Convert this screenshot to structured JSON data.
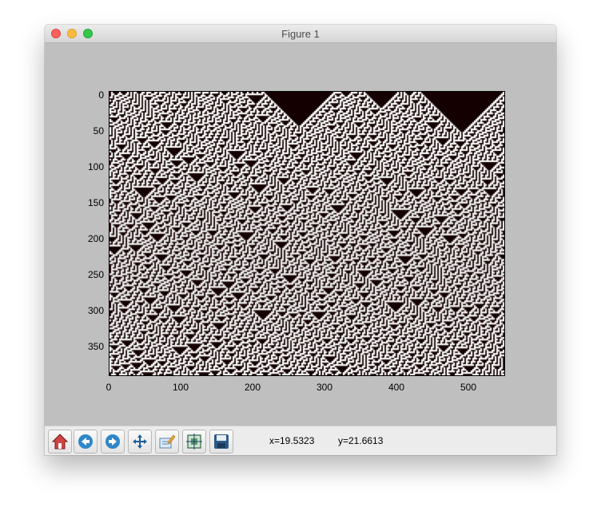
{
  "window": {
    "title": "Figure 1"
  },
  "axes": {
    "y_ticks": [
      "0",
      "50",
      "100",
      "150",
      "200",
      "250",
      "300",
      "350"
    ],
    "x_ticks": [
      "0",
      "100",
      "200",
      "300",
      "400",
      "500"
    ],
    "xlim": [
      0,
      550
    ],
    "ylim": [
      390,
      0
    ]
  },
  "colors": {
    "background_cells": "#140000",
    "active_cells": "#ffffff",
    "figure_bg": "#bfbfbf"
  },
  "toolbar": {
    "buttons": [
      {
        "icon": "home-icon",
        "tooltip": "Home"
      },
      {
        "icon": "back-arrow-icon",
        "tooltip": "Back"
      },
      {
        "icon": "forward-arrow-icon",
        "tooltip": "Forward"
      },
      {
        "icon": "pan-icon",
        "tooltip": "Pan"
      },
      {
        "icon": "zoom-icon",
        "tooltip": "Zoom"
      },
      {
        "icon": "subplots-icon",
        "tooltip": "Configure subplots"
      },
      {
        "icon": "save-icon",
        "tooltip": "Save"
      }
    ],
    "x_readout": "x=19.5323",
    "y_readout": "y=21.6613"
  }
}
